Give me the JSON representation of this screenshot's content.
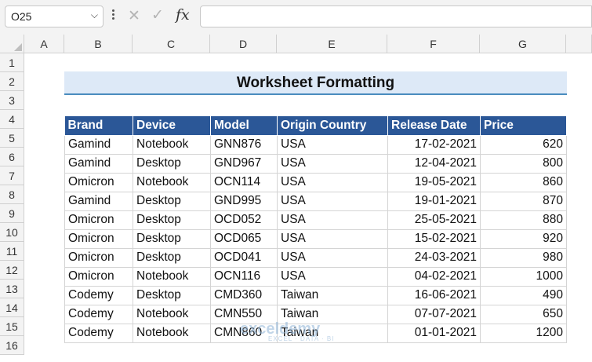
{
  "formula_bar": {
    "name_box": "O25",
    "name_box_chevron": "chevron-down-icon",
    "cancel_glyph": "✕",
    "enter_glyph": "✓",
    "fx_label": "fx",
    "formula": ""
  },
  "columns": [
    "A",
    "B",
    "C",
    "D",
    "E",
    "F",
    "G"
  ],
  "rows": [
    "1",
    "2",
    "3",
    "4",
    "5",
    "6",
    "7",
    "8",
    "9",
    "10",
    "11",
    "12",
    "13",
    "14",
    "15",
    "16"
  ],
  "title": "Worksheet Formatting",
  "table": {
    "headers": [
      "Brand",
      "Device",
      "Model",
      "Origin Country",
      "Release Date",
      "Price"
    ],
    "rows": [
      [
        "Gamind",
        "Notebook",
        "GNN876",
        "USA",
        "17-02-2021",
        "620"
      ],
      [
        "Gamind",
        "Desktop",
        "GND967",
        "USA",
        "12-04-2021",
        "800"
      ],
      [
        "Omicron",
        "Notebook",
        "OCN114",
        "USA",
        "19-05-2021",
        "860"
      ],
      [
        "Gamind",
        "Desktop",
        "GND995",
        "USA",
        "19-01-2021",
        "870"
      ],
      [
        "Omicron",
        "Desktop",
        "OCD052",
        "USA",
        "25-05-2021",
        "880"
      ],
      [
        "Omicron",
        "Desktop",
        "OCD065",
        "USA",
        "15-02-2021",
        "920"
      ],
      [
        "Omicron",
        "Desktop",
        "OCD041",
        "USA",
        "24-03-2021",
        "980"
      ],
      [
        "Omicron",
        "Notebook",
        "OCN116",
        "USA",
        "04-02-2021",
        "1000"
      ],
      [
        "Codemy",
        "Desktop",
        "CMD360",
        "Taiwan",
        "16-06-2021",
        "490"
      ],
      [
        "Codemy",
        "Notebook",
        "CMN550",
        "Taiwan",
        "07-07-2021",
        "650"
      ],
      [
        "Codemy",
        "Notebook",
        "CMN860",
        "Taiwan",
        "01-01-2021",
        "1200"
      ]
    ]
  },
  "watermark": {
    "name": "exceldemy",
    "tagline": "EXCEL · DATA · BI"
  },
  "colors": {
    "header_fill": "#2b5797",
    "title_fill": "#dde9f7",
    "title_border": "#4a8cbe",
    "gridline": "#d4d4d4"
  }
}
